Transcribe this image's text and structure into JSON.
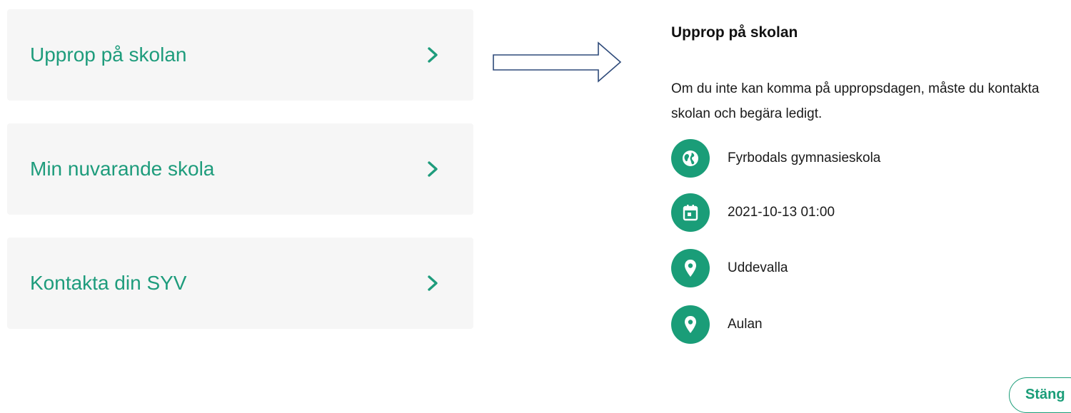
{
  "menu": {
    "items": [
      {
        "label": "Upprop på skolan"
      },
      {
        "label": "Min nuvarande skola"
      },
      {
        "label": "Kontakta din SYV"
      }
    ]
  },
  "panel": {
    "title": "Upprop på skolan",
    "description": "Om du inte kan komma på uppropsdagen, måste du kontakta skolan och begära ledigt.",
    "rows": [
      {
        "icon": "globe-icon",
        "text": "Fyrbodals gymnasieskola"
      },
      {
        "icon": "calendar-icon",
        "text": "2021-10-13 01:00"
      },
      {
        "icon": "location-pin-icon",
        "text": "Uddevalla"
      },
      {
        "icon": "location-pin-icon",
        "text": "Aulan"
      }
    ],
    "close_label": "Stäng"
  },
  "colors": {
    "accent": "#1a9d78",
    "menu_text": "#1e9c7c",
    "menu_bg": "#f6f6f6",
    "arrow": "#2e4a7a"
  }
}
